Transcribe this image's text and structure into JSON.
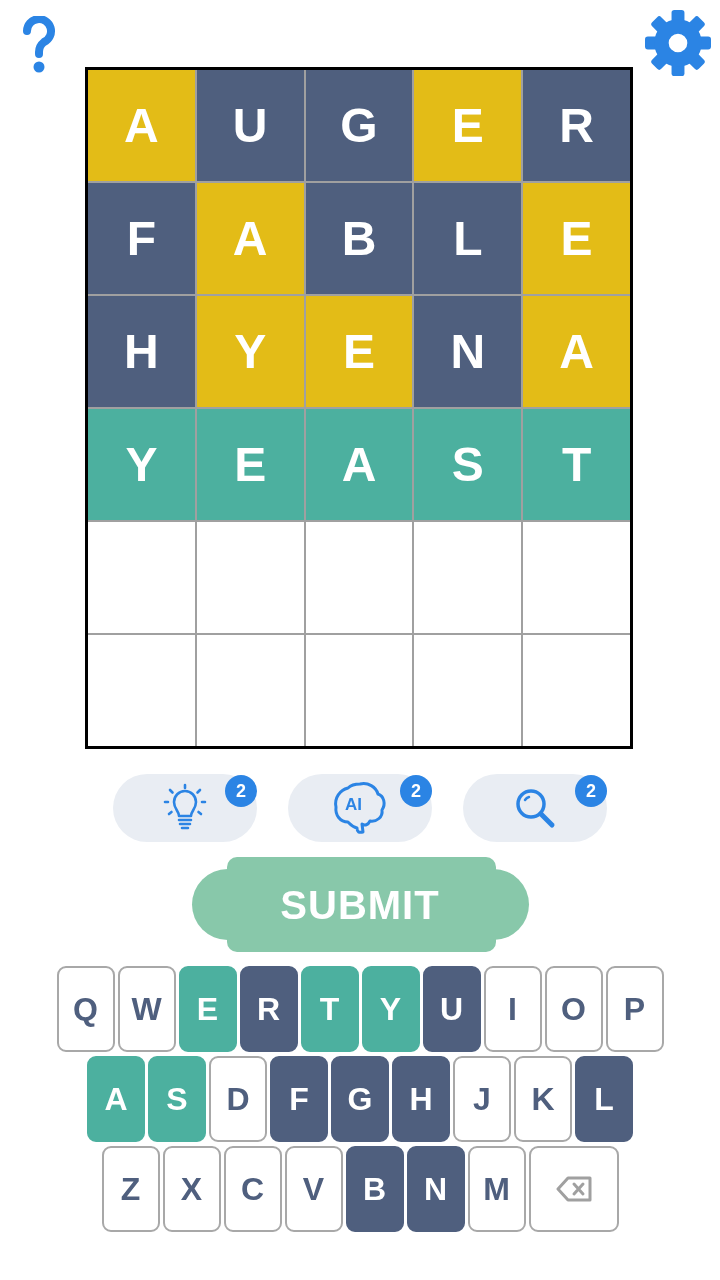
{
  "board": {
    "rows": [
      {
        "cells": [
          {
            "filled": true,
            "letter": "A",
            "color": "#e3bc17"
          },
          {
            "filled": true,
            "letter": "U",
            "color": "#4f5f7e"
          },
          {
            "filled": true,
            "letter": "G",
            "color": "#4f5f7e"
          },
          {
            "filled": true,
            "letter": "E",
            "color": "#e3bc17"
          },
          {
            "filled": true,
            "letter": "R",
            "color": "#4f5f7e"
          }
        ]
      },
      {
        "cells": [
          {
            "filled": true,
            "letter": "F",
            "color": "#4f5f7e"
          },
          {
            "filled": true,
            "letter": "A",
            "color": "#e3bc17"
          },
          {
            "filled": true,
            "letter": "B",
            "color": "#4f5f7e"
          },
          {
            "filled": true,
            "letter": "L",
            "color": "#4f5f7e"
          },
          {
            "filled": true,
            "letter": "E",
            "color": "#e3bc17"
          }
        ]
      },
      {
        "cells": [
          {
            "filled": true,
            "letter": "H",
            "color": "#4f5f7e"
          },
          {
            "filled": true,
            "letter": "Y",
            "color": "#e3bc17"
          },
          {
            "filled": true,
            "letter": "E",
            "color": "#e3bc17"
          },
          {
            "filled": true,
            "letter": "N",
            "color": "#4f5f7e"
          },
          {
            "filled": true,
            "letter": "A",
            "color": "#e3bc17"
          }
        ]
      },
      {
        "cells": [
          {
            "filled": true,
            "letter": "Y",
            "color": "#4cb09f"
          },
          {
            "filled": true,
            "letter": "E",
            "color": "#4cb09f"
          },
          {
            "filled": true,
            "letter": "A",
            "color": "#4cb09f"
          },
          {
            "filled": true,
            "letter": "S",
            "color": "#4cb09f"
          },
          {
            "filled": true,
            "letter": "T",
            "color": "#4cb09f"
          }
        ]
      },
      {
        "cells": [
          {
            "filled": false
          },
          {
            "filled": false
          },
          {
            "filled": false
          },
          {
            "filled": false
          },
          {
            "filled": false
          }
        ]
      },
      {
        "cells": [
          {
            "filled": false
          },
          {
            "filled": false
          },
          {
            "filled": false
          },
          {
            "filled": false
          },
          {
            "filled": false
          }
        ]
      }
    ]
  },
  "hint_buttons": [
    {
      "kind": "bulb",
      "badge": "2"
    },
    {
      "kind": "ai",
      "label": "AI",
      "badge": "2"
    },
    {
      "kind": "search",
      "badge": "2"
    }
  ],
  "submit_button": {
    "label": "SUBMIT"
  },
  "keyboard": {
    "rows": [
      {
        "keys": [
          {
            "kind": "letter",
            "label": "Q"
          },
          {
            "kind": "letter",
            "label": "W"
          },
          {
            "kind": "letter",
            "label": "E",
            "color": "#4cb09f"
          },
          {
            "kind": "letter",
            "label": "R",
            "color": "#4f5f7e"
          },
          {
            "kind": "letter",
            "label": "T",
            "color": "#4cb09f"
          },
          {
            "kind": "letter",
            "label": "Y",
            "color": "#4cb09f"
          },
          {
            "kind": "letter",
            "label": "U",
            "color": "#4f5f7e"
          },
          {
            "kind": "letter",
            "label": "I"
          },
          {
            "kind": "letter",
            "label": "O"
          },
          {
            "kind": "letter",
            "label": "P"
          }
        ]
      },
      {
        "keys": [
          {
            "kind": "letter",
            "label": "A",
            "color": "#4cb09f"
          },
          {
            "kind": "letter",
            "label": "S",
            "color": "#4cb09f"
          },
          {
            "kind": "letter",
            "label": "D"
          },
          {
            "kind": "letter",
            "label": "F",
            "color": "#4f5f7e"
          },
          {
            "kind": "letter",
            "label": "G",
            "color": "#4f5f7e"
          },
          {
            "kind": "letter",
            "label": "H",
            "color": "#4f5f7e"
          },
          {
            "kind": "letter",
            "label": "J"
          },
          {
            "kind": "letter",
            "label": "K"
          },
          {
            "kind": "letter",
            "label": "L",
            "color": "#4f5f7e"
          }
        ]
      },
      {
        "keys": [
          {
            "kind": "letter",
            "label": "Z"
          },
          {
            "kind": "letter",
            "label": "X"
          },
          {
            "kind": "letter",
            "label": "C"
          },
          {
            "kind": "letter",
            "label": "V"
          },
          {
            "kind": "letter",
            "label": "B",
            "color": "#4f5f7e"
          },
          {
            "kind": "letter",
            "label": "N",
            "color": "#4f5f7e"
          },
          {
            "kind": "letter",
            "label": "M"
          },
          {
            "kind": "backspace"
          }
        ]
      }
    ]
  }
}
